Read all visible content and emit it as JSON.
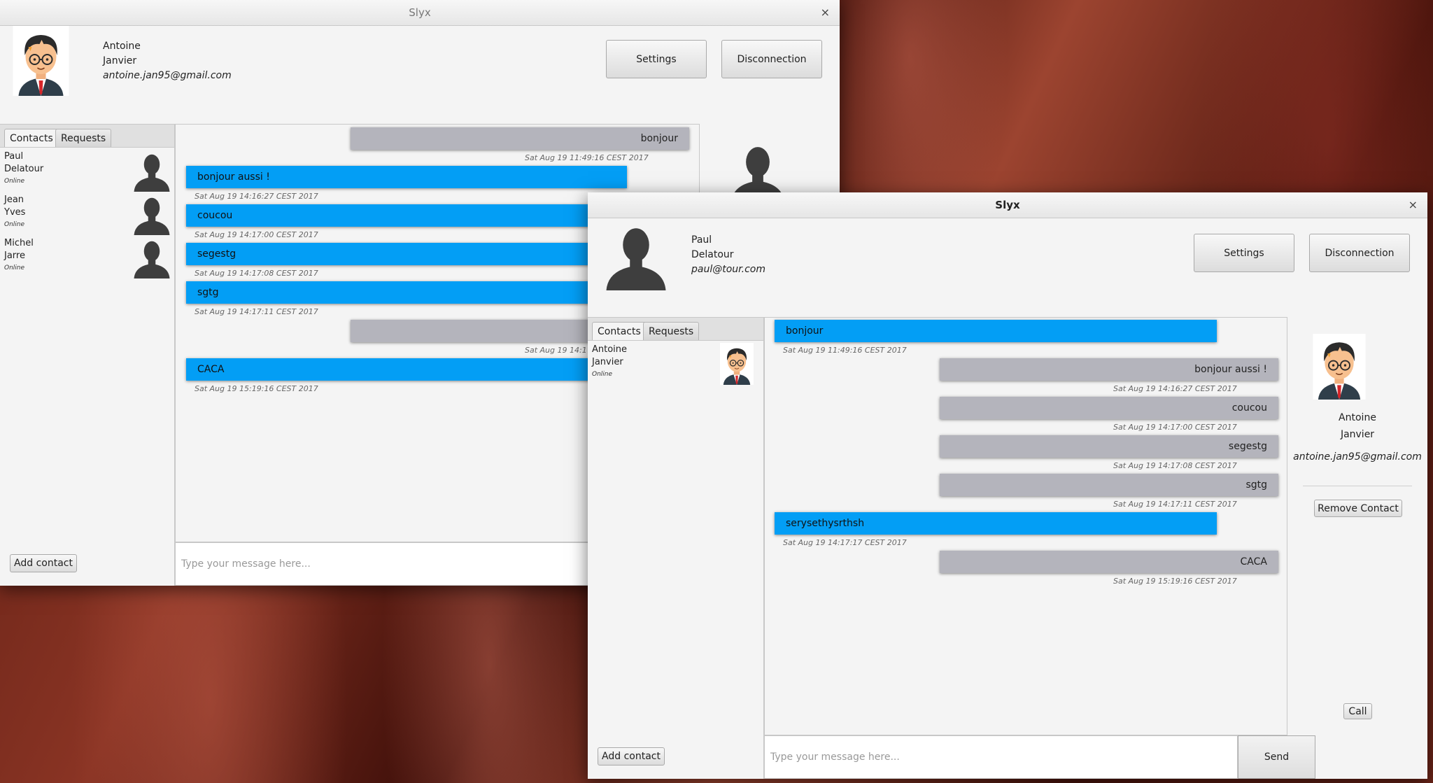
{
  "app_title": "Slyx",
  "close_glyph": "×",
  "window1": {
    "user": {
      "first": "Antoine",
      "last": "Janvier",
      "email": "antoine.jan95@gmail.com",
      "avatar_icon": "nerd-avatar-icon"
    },
    "buttons": {
      "settings": "Settings",
      "disconnect": "Disconnection"
    },
    "tabs": [
      "Contacts",
      "Requests"
    ],
    "contacts": [
      {
        "first": "Paul",
        "last": "Delatour",
        "status": "Online"
      },
      {
        "first": "Jean",
        "last": "Yves",
        "status": "Online"
      },
      {
        "first": "Michel",
        "last": "Jarre",
        "status": "Online"
      }
    ],
    "add_contact": "Add contact",
    "input_placeholder": "Type your message here...",
    "messages": [
      {
        "side": "right",
        "text": "bonjour",
        "time": "Sat Aug 19 11:49:16 CEST 2017"
      },
      {
        "side": "left",
        "text": "bonjour aussi !",
        "time": "Sat Aug 19 14:16:27 CEST 2017"
      },
      {
        "side": "left",
        "text": "coucou",
        "time": "Sat Aug 19 14:17:00 CEST 2017"
      },
      {
        "side": "left",
        "text": "segestg",
        "time": "Sat Aug 19 14:17:08 CEST 2017"
      },
      {
        "side": "left",
        "text": "sgtg",
        "time": "Sat Aug 19 14:17:11 CEST 2017"
      },
      {
        "side": "right",
        "text": "",
        "time": "Sat Aug 19 14:1"
      },
      {
        "side": "left",
        "text": "CACA",
        "time": "Sat Aug 19 15:19:16 CEST 2017"
      }
    ]
  },
  "window2": {
    "user": {
      "first": "Paul",
      "last": "Delatour",
      "email": "paul@tour.com",
      "avatar_icon": "person-silhouette-icon"
    },
    "buttons": {
      "settings": "Settings",
      "disconnect": "Disconnection"
    },
    "tabs": [
      "Contacts",
      "Requests"
    ],
    "contacts": [
      {
        "first": "Antoine",
        "last": "Janvier",
        "status": "Online"
      }
    ],
    "add_contact": "Add contact",
    "input_placeholder": "Type your message here...",
    "send": "Send",
    "messages": [
      {
        "side": "left",
        "text": "bonjour",
        "time": "Sat Aug 19 11:49:16 CEST 2017"
      },
      {
        "side": "right",
        "text": "bonjour aussi !",
        "time": "Sat Aug 19 14:16:27 CEST 2017"
      },
      {
        "side": "right",
        "text": "coucou",
        "time": "Sat Aug 19 14:17:00 CEST 2017"
      },
      {
        "side": "right",
        "text": "segestg",
        "time": "Sat Aug 19 14:17:08 CEST 2017"
      },
      {
        "side": "right",
        "text": "sgtg",
        "time": "Sat Aug 19 14:17:11 CEST 2017"
      },
      {
        "side": "left",
        "text": "serysethysrthsh",
        "time": "Sat Aug 19 14:17:17 CEST 2017"
      },
      {
        "side": "right",
        "text": "CACA",
        "time": "Sat Aug 19 15:19:16 CEST 2017"
      }
    ],
    "selected_contact": {
      "first": "Antoine",
      "last": "Janvier",
      "email": "antoine.jan95@gmail.com"
    },
    "remove_contact": "Remove Contact",
    "call": "Call"
  },
  "colors": {
    "bubble_blue": "#039ef5",
    "bubble_gray": "#b4b4bc",
    "window_bg": "#f4f4f4"
  }
}
